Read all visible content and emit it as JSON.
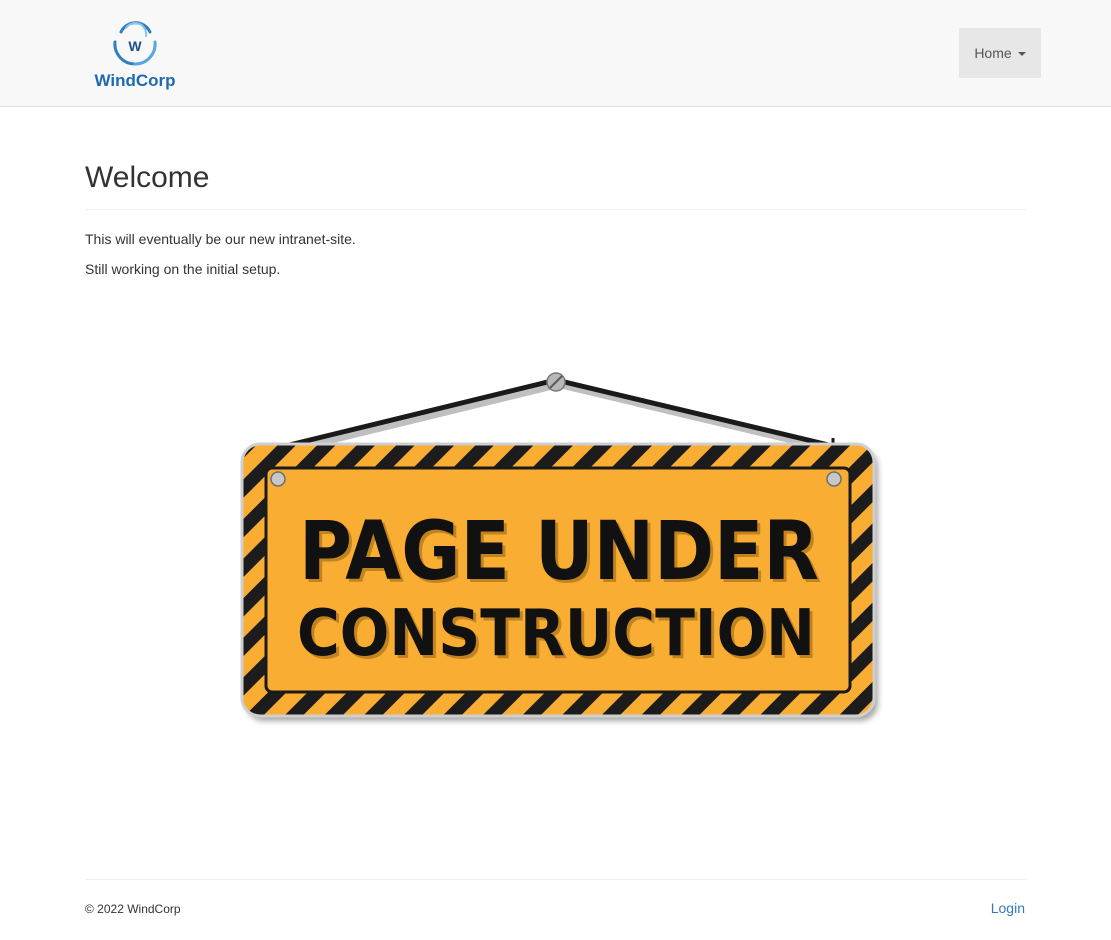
{
  "navbar": {
    "brand": {
      "logo_letter": "W",
      "logo_text": "WindCorp",
      "colors": {
        "swirl": "#2f7fc0",
        "text": "#1e6ab0"
      }
    },
    "menu": {
      "label": "Home"
    }
  },
  "main": {
    "title": "Welcome",
    "paragraphs": [
      "This will eventually be our new intranet-site.",
      "Still working on the initial setup."
    ],
    "sign": {
      "line1": "PAGE UNDER",
      "line2": "CONSTRUCTION",
      "colors": {
        "fill": "#f9ad32",
        "stripes": "#1a1a1a",
        "text": "#111111"
      }
    }
  },
  "footer": {
    "copyright": "© 2022 WindCorp",
    "login_label": "Login"
  }
}
